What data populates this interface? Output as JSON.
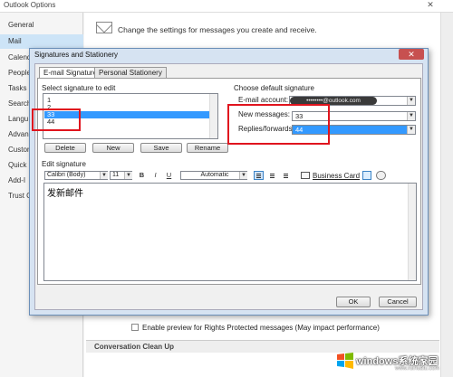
{
  "background_window": {
    "title": "Outlook Options",
    "close_glyph": "✕",
    "nav": [
      {
        "label": "General",
        "active": false
      },
      {
        "label": "Mail",
        "active": true
      },
      {
        "label": "Calend",
        "active": false
      },
      {
        "label": "People",
        "active": false
      },
      {
        "label": "Tasks",
        "active": false
      },
      {
        "label": "Search",
        "active": false
      },
      {
        "label": "Langu",
        "active": false
      },
      {
        "label": "Advan",
        "active": false
      },
      {
        "label": "Custon",
        "active": false
      },
      {
        "label": "Quick",
        "active": false
      },
      {
        "label": "Add-I",
        "active": false
      },
      {
        "label": "Trust C",
        "active": false
      }
    ],
    "description": "Change the settings for messages you create and receive.",
    "rights_protected_checkbox_label": "Enable preview for Rights Protected messages (May impact performance)",
    "section_header": "Conversation Clean Up"
  },
  "dialog": {
    "title": "Signatures and Stationery",
    "close_glyph": "✕",
    "tabs": [
      {
        "label": "E-mail Signature",
        "active": true
      },
      {
        "label": "Personal Stationery",
        "active": false
      }
    ],
    "select_signature_label": "Select signature to edit",
    "signatures": [
      {
        "name": "1",
        "selected": false
      },
      {
        "name": "2",
        "selected": false
      },
      {
        "name": "33",
        "selected": true
      },
      {
        "name": "44",
        "selected": false
      }
    ],
    "buttons": {
      "delete": "Delete",
      "new": "New",
      "save": "Save",
      "rename": "Rename",
      "ok": "OK",
      "cancel": "Cancel"
    },
    "default_signature": {
      "heading": "Choose default signature",
      "email_account_label": "E-mail account:",
      "email_account_value": "••••••••@outlook.com",
      "new_messages_label": "New messages:",
      "new_messages_value": "33",
      "replies_label": "Replies/forwards:",
      "replies_value": "44"
    },
    "edit_signature": {
      "heading": "Edit signature",
      "font": "Calibri (Body)",
      "size": "11",
      "bold": "B",
      "italic": "I",
      "underline": "U",
      "color": "Automatic",
      "business_card": "Business Card",
      "content": "发新邮件"
    }
  },
  "watermark": {
    "text": "windows系统家园",
    "sub": "www.ruihuatu.com"
  },
  "colors": {
    "selection": "#3399ff",
    "annotation_red": "#e0141e"
  }
}
